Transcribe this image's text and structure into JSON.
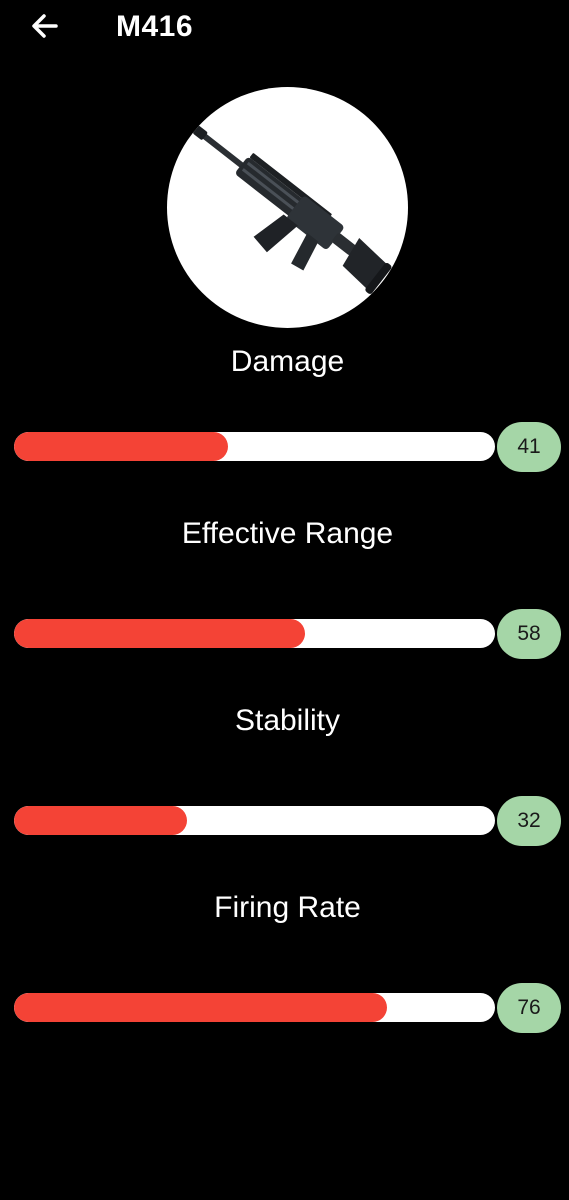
{
  "header": {
    "title": "M416",
    "back_icon": "arrow-left-icon"
  },
  "weapon": {
    "image": "m416-rifle-image"
  },
  "colors": {
    "background": "#000000",
    "bar_fill": "#f44336",
    "bar_track": "#ffffff",
    "badge": "#a5d6a7"
  },
  "stats": [
    {
      "label": "Damage",
      "value": "41",
      "fill_fraction": 0.445
    },
    {
      "label": "Effective Range",
      "value": "58",
      "fill_fraction": 0.605
    },
    {
      "label": "Stability",
      "value": "32",
      "fill_fraction": 0.36
    },
    {
      "label": "Firing Rate",
      "value": "76",
      "fill_fraction": 0.775
    }
  ]
}
